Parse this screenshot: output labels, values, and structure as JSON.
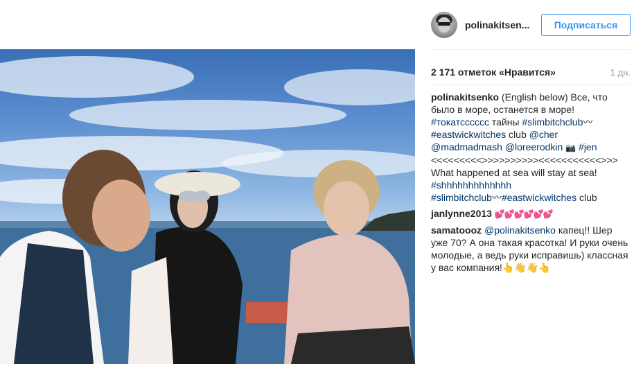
{
  "header": {
    "username": "polinakitsen...",
    "follow_label": "Подписаться"
  },
  "post": {
    "likes": "2 171 отметок «Нравится»",
    "time": "1 дн."
  },
  "caption": {
    "user": "polinakitsenko",
    "text1": " (English below) Все, что было в море, останется в море! ",
    "tag1": "#токатсссссс",
    "text2": " тайны ",
    "tag2": "#slimbitchclub",
    "text3": "〰",
    "tag3": "#eastwickwitches",
    "text4": " club ",
    "tag4": "@cher",
    "tag5": "@madmadmash",
    "tag6": "@loreerodkin",
    "tag7": "#jen",
    "separator": "<<<<<<<<<>>>>>>>>>><<<<<<<<<<<>>>",
    "english": "What happened at sea will stay at sea!",
    "tag8": "#shhhhhhhhhhhhh",
    "tag9": "#slimbitchclub",
    "tag10": "#eastwickwitches",
    "text5": " club"
  },
  "comments": [
    {
      "user": "janlynne2013",
      "hearts": "💕💕💕💕💕💕"
    },
    {
      "user": "samatoooz",
      "mention": "@polinakitsenko",
      "text": " капец!! Шер уже 70? А она такая красотка! И руки очень молодые, а ведь руки исправишь) классная у вас компания!👆👋👋👆"
    }
  ],
  "icons": {
    "camera": "📷",
    "wave": "〰"
  }
}
